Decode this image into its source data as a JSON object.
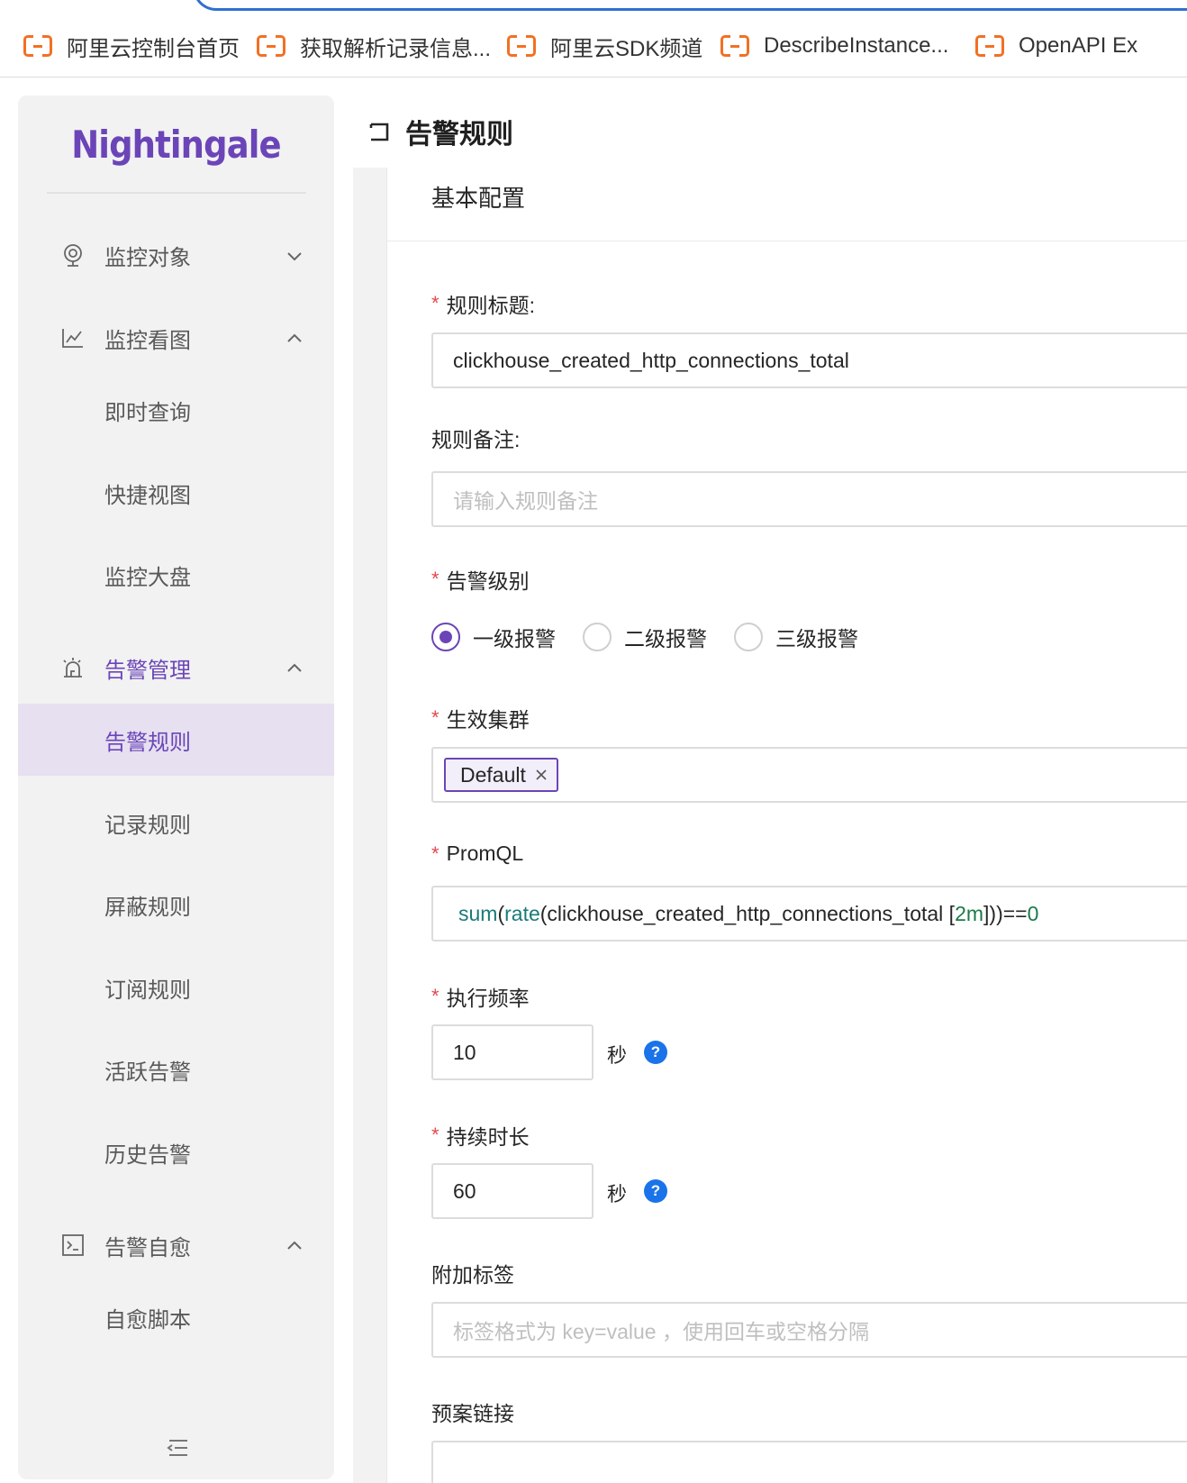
{
  "bookmarks": [
    {
      "label": "阿里云控制台首页",
      "icon": "aliyun-icon"
    },
    {
      "label": "获取解析记录信息...",
      "icon": "aliyun-icon"
    },
    {
      "label": "阿里云SDK频道",
      "icon": "aliyun-icon"
    },
    {
      "label": "DescribeInstance...",
      "icon": "aliyun-icon"
    },
    {
      "label": "OpenAPI Ex",
      "icon": "aliyun-icon"
    }
  ],
  "sidebar": {
    "logo": "Nightingale",
    "groups": [
      {
        "label": "监控对象",
        "icon": "target-icon",
        "expanded": false
      },
      {
        "label": "监控看图",
        "icon": "chart-icon",
        "expanded": true,
        "items": [
          "即时查询",
          "快捷视图",
          "监控大盘"
        ]
      },
      {
        "label": "告警管理",
        "icon": "alarm-icon",
        "expanded": true,
        "active": true,
        "items": [
          "告警规则",
          "记录规则",
          "屏蔽规则",
          "订阅规则",
          "活跃告警",
          "历史告警"
        ]
      },
      {
        "label": "告警自愈",
        "icon": "terminal-icon",
        "expanded": true,
        "items": [
          "自愈脚本"
        ]
      }
    ],
    "selected_item": "告警规则"
  },
  "header": {
    "title": "告警规则"
  },
  "form": {
    "section_title": "基本配置",
    "rule_title": {
      "label": "规则标题:",
      "value": "clickhouse_created_http_connections_total",
      "required": true
    },
    "rule_note": {
      "label": "规则备注:",
      "placeholder": "请输入规则备注",
      "required": false
    },
    "severity": {
      "label": "告警级别",
      "required": true,
      "options": [
        "一级报警",
        "二级报警",
        "三级报警"
      ],
      "selected": "一级报警"
    },
    "cluster": {
      "label": "生效集群",
      "required": true,
      "tags": [
        "Default"
      ]
    },
    "promql": {
      "label": "PromQL",
      "required": true,
      "tokens": [
        {
          "t": "sum",
          "k": "fn"
        },
        {
          "t": "(",
          "k": "plain"
        },
        {
          "t": "rate",
          "k": "fn"
        },
        {
          "t": "(clickhouse_created_http_connections_total [",
          "k": "plain"
        },
        {
          "t": "2m",
          "k": "num"
        },
        {
          "t": "]))==",
          "k": "plain"
        },
        {
          "t": "0",
          "k": "num"
        }
      ]
    },
    "frequency": {
      "label": "执行频率",
      "required": true,
      "value": "10",
      "unit": "秒"
    },
    "duration": {
      "label": "持续时长",
      "required": true,
      "value": "60",
      "unit": "秒"
    },
    "extra_labels": {
      "label": "附加标签",
      "placeholder": "标签格式为 key=value ，使用回车或空格分隔"
    },
    "runbook": {
      "label": "预案链接",
      "value": ""
    }
  },
  "colors": {
    "accent": "#6b45b8",
    "required": "#e5484d",
    "help": "#1a73e8",
    "bookmark_icon": "#f27023"
  }
}
